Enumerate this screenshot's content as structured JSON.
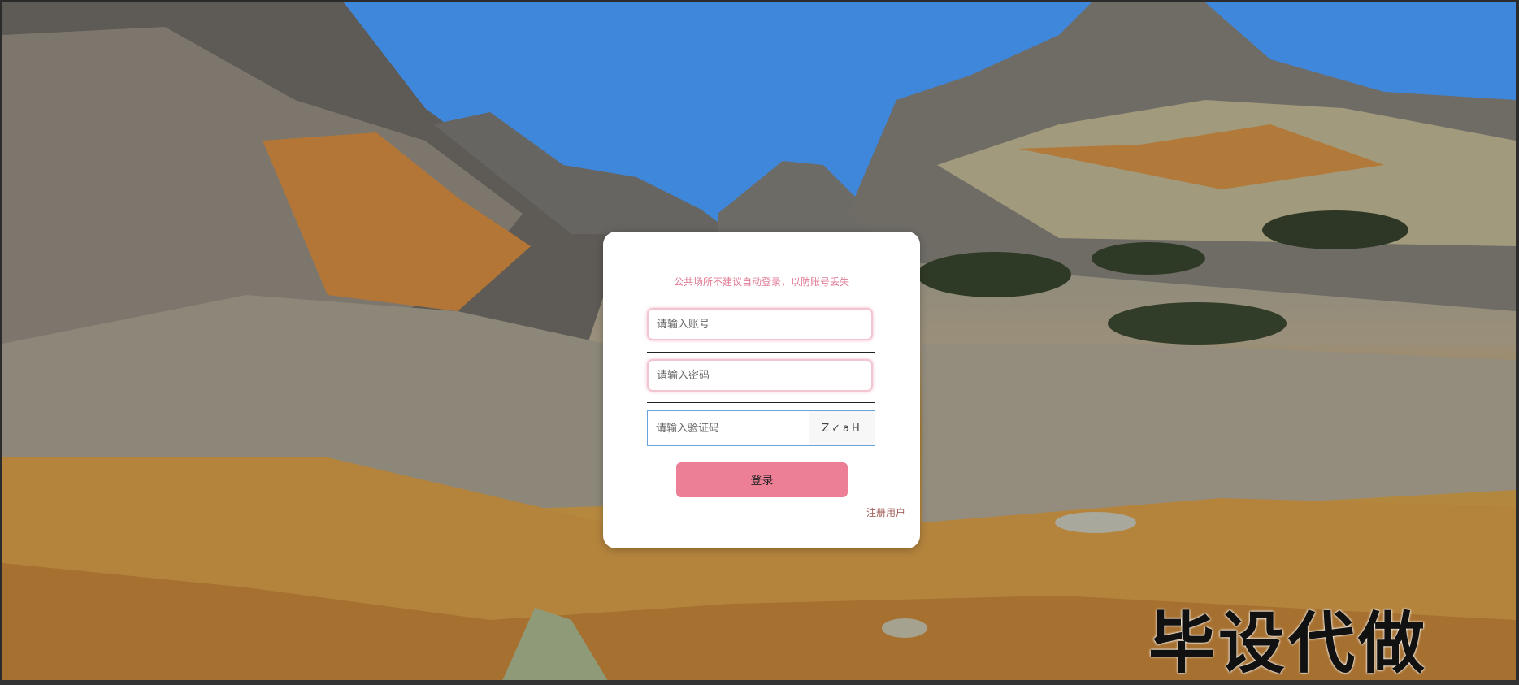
{
  "notice": "公共场所不建议自动登录，以防账号丢失",
  "form": {
    "account_placeholder": "请输入账号",
    "password_placeholder": "请输入密码",
    "captcha_placeholder": "请输入验证码",
    "captcha_code": "Z✓aH",
    "login_label": "登录",
    "register_label": "注册用户"
  },
  "watermark": "毕设代做",
  "colors": {
    "accent": "#ec7f95",
    "notice_text": "#e07b94",
    "input_border": "#f3c5d1",
    "captcha_border": "#6aa3e0"
  }
}
